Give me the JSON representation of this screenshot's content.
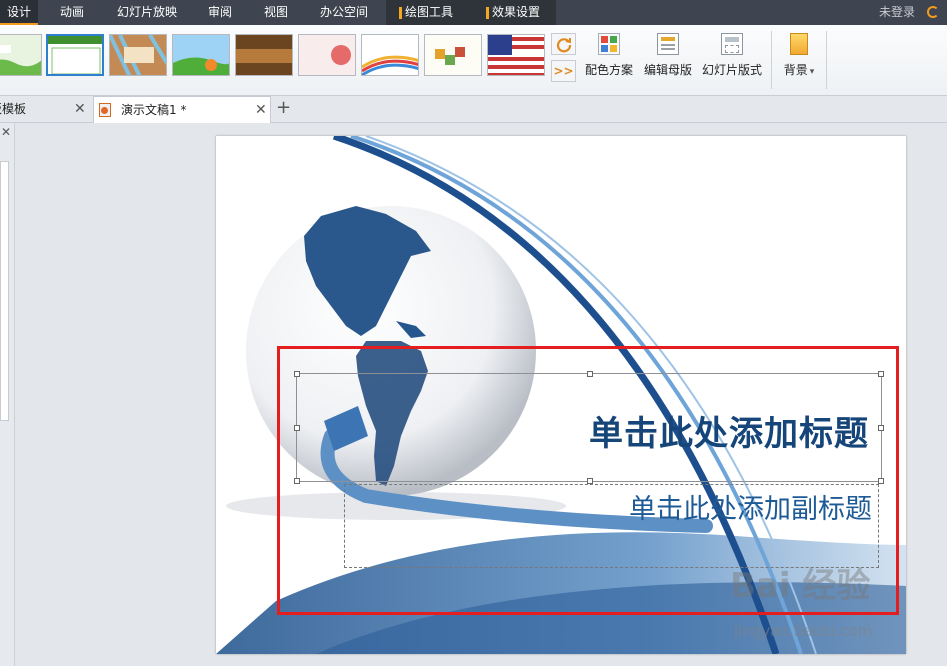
{
  "menu": {
    "items": [
      "设计",
      "动画",
      "幻灯片放映",
      "审阅",
      "视图",
      "办公空间"
    ],
    "context_tabs": [
      "绘图工具",
      "效果设置"
    ],
    "login": "未登录"
  },
  "ribbon": {
    "template_thumbs_count": 9,
    "refresh_icon": "refresh-icon",
    "more_label": ">>",
    "buttons": {
      "color_scheme": "配色方案",
      "edit_master": "编辑母版",
      "slide_layout": "幻灯片版式",
      "background": "背景"
    },
    "background_arrow": "▾"
  },
  "tabs": {
    "left_tab_label": "板模板",
    "doc_tab_label": "演示文稿1 *",
    "close_glyph": "✕",
    "new_tab_glyph": "+"
  },
  "slide": {
    "title_placeholder": "单击此处添加标题",
    "subtitle_placeholder": "单击此处添加副标题"
  },
  "watermark": {
    "main": "Bai 经验",
    "sub": "jingyan.baidu.com"
  },
  "colors": {
    "menubar_bg": "#3e4550",
    "accent_orange": "#f39b1e",
    "title_blue": "#16457a",
    "highlight_red": "#e41e1e"
  }
}
